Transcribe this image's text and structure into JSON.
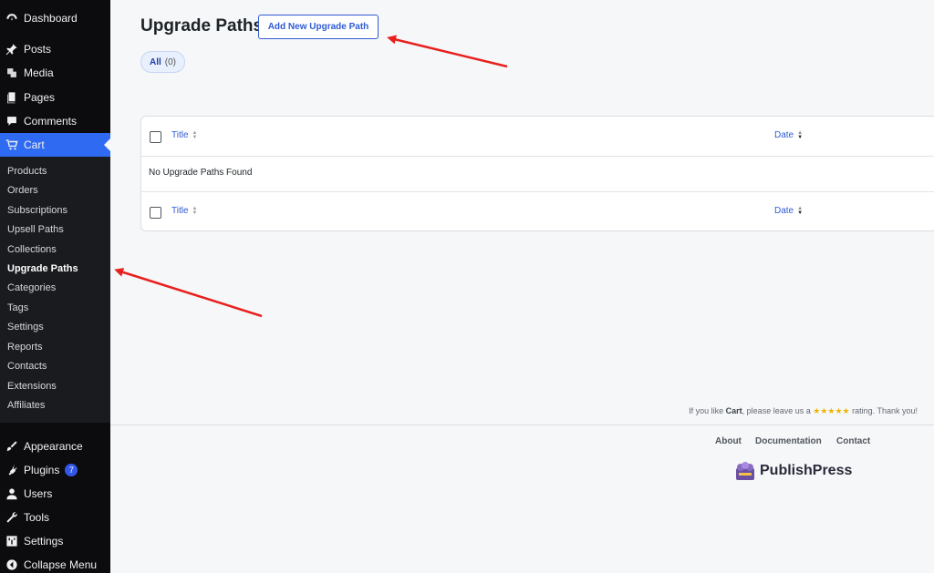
{
  "sidebar": {
    "items": [
      {
        "label": "Dashboard",
        "icon": "dashboard-icon"
      },
      {
        "label": "Posts",
        "icon": "pin-icon"
      },
      {
        "label": "Media",
        "icon": "media-icon"
      },
      {
        "label": "Pages",
        "icon": "pages-icon"
      },
      {
        "label": "Comments",
        "icon": "comment-icon"
      },
      {
        "label": "Cart",
        "icon": "cart-icon"
      },
      {
        "label": "Appearance",
        "icon": "brush-icon"
      },
      {
        "label": "Plugins",
        "icon": "plugin-icon",
        "badge": "7"
      },
      {
        "label": "Users",
        "icon": "user-icon"
      },
      {
        "label": "Tools",
        "icon": "wrench-icon"
      },
      {
        "label": "Settings",
        "icon": "settings-icon"
      },
      {
        "label": "Collapse Menu",
        "icon": "collapse-icon"
      }
    ],
    "submenu": [
      "Products",
      "Orders",
      "Subscriptions",
      "Upsell Paths",
      "Collections",
      "Upgrade Paths",
      "Categories",
      "Tags",
      "Settings",
      "Reports",
      "Contacts",
      "Extensions",
      "Affiliates"
    ]
  },
  "main": {
    "title": "Upgrade Paths",
    "add_button": "Add New Upgrade Path",
    "filter": {
      "label": "All",
      "count": "(0)"
    },
    "table": {
      "col_title": "Title",
      "col_date": "Date",
      "empty_message": "No Upgrade Paths Found"
    }
  },
  "footer": {
    "rating_prefix": "If you like",
    "rating_brand": "Cart",
    "rating_middle": ", please leave us a",
    "rating_stars": "★★★★★",
    "rating_suffix": "rating. Thank you!",
    "links": [
      "About",
      "Documentation",
      "Contact"
    ],
    "logo_text": "PublishPress"
  },
  "colors": {
    "accent": "#2f6bf2",
    "sidebar_bg": "#0c0c0e",
    "annotation": "#e8201e",
    "star": "#f0b400"
  }
}
